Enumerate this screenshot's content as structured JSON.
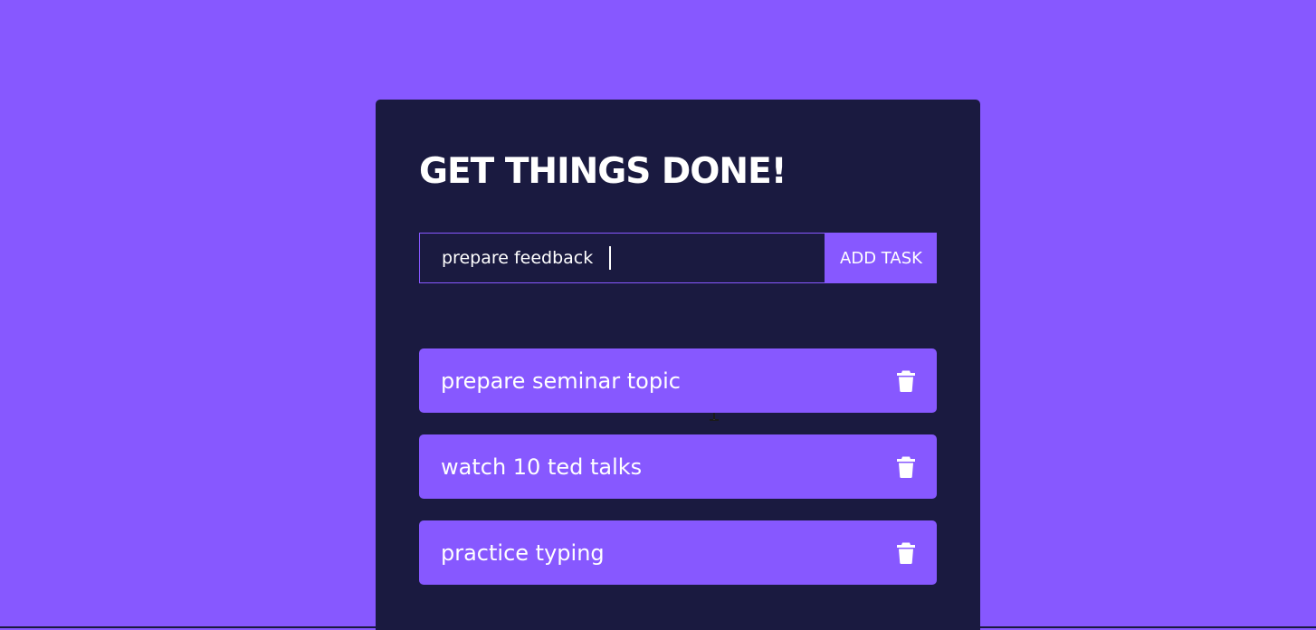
{
  "app": {
    "title": "GET THINGS DONE!"
  },
  "form": {
    "input_value": "prepare feedback",
    "button_label": "ADD TASK"
  },
  "tasks": [
    {
      "label": "prepare seminar topic",
      "icon": "trash-icon"
    },
    {
      "label": "watch 10 ted talks",
      "icon": "trash-icon"
    },
    {
      "label": "practice typing",
      "icon": "trash-icon"
    }
  ],
  "colors": {
    "background": "#8758ff",
    "card": "#1a1a40",
    "accent": "#8758ff",
    "text": "#ffffff"
  }
}
